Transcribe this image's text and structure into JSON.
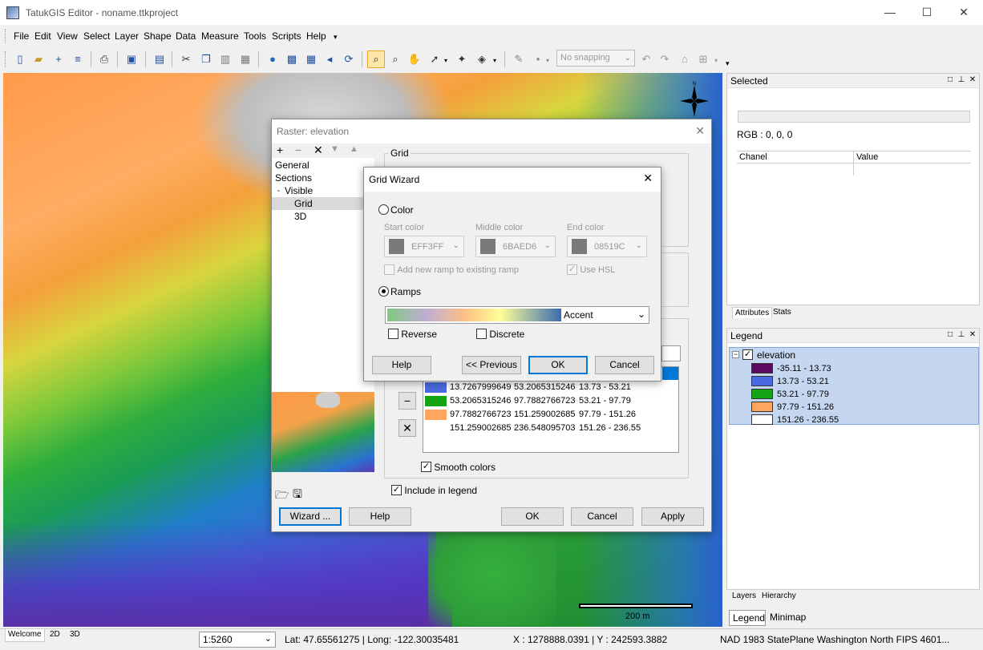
{
  "window": {
    "title": "TatukGIS Editor - noname.ttkproject",
    "minimize": "—",
    "maximize": "☐",
    "close": "✕"
  },
  "menu": [
    "File",
    "Edit",
    "View",
    "Select",
    "Layer",
    "Shape",
    "Data",
    "Measure",
    "Tools",
    "Scripts",
    "Help"
  ],
  "toolbar": {
    "snapping": "No snapping"
  },
  "map": {
    "scale_label": "200 m",
    "north_label": "N"
  },
  "selected_panel": {
    "title": "Selected",
    "rgb": "RGB : 0, 0, 0",
    "col_chanel": "Chanel",
    "col_value": "Value",
    "tab_attributes": "Attributes",
    "tab_stats": "Stats"
  },
  "legend_panel": {
    "title": "Legend",
    "layer_name": "elevation",
    "items": [
      {
        "label": "-35.11 - 13.73",
        "color": "#5b0a5f"
      },
      {
        "label": "13.73 - 53.21",
        "color": "#4a6ae0"
      },
      {
        "label": "53.21 - 97.79",
        "color": "#13a313"
      },
      {
        "label": "97.79 - 151.26",
        "color": "#ffa560"
      },
      {
        "label": "151.26 - 236.55",
        "color": "#ffffff"
      }
    ],
    "tab_layers": "Layers",
    "tab_hierarchy": "Hierarchy",
    "btab_legend": "Legend",
    "btab_minimap": "Minimap"
  },
  "raster_dialog": {
    "title": "Raster: elevation",
    "tree": [
      "General",
      "Sections",
      "Visible",
      "Grid",
      "3D"
    ],
    "group_title": "Grid",
    "rows": [
      {
        "c1": "13.7267999649",
        "c2": "53.2065315246",
        "c3": "13.73 - 53.21",
        "color": "#4a6ae0"
      },
      {
        "c1": "53.2065315246",
        "c2": "97.7882766723",
        "c3": "53.21 - 97.79",
        "color": "#13a313"
      },
      {
        "c1": "97.7882766723",
        "c2": "151.259002685",
        "c3": "97.79 - 151.26",
        "color": "#ffa560"
      },
      {
        "c1": "151.259002685",
        "c2": "236.548095703",
        "c3": "151.26 - 236.55",
        "color": "#ffffff"
      }
    ],
    "smooth_colors": "Smooth colors",
    "include_in_legend": "Include in legend",
    "btn_wizard": "Wizard ...",
    "btn_help": "Help",
    "btn_ok": "OK",
    "btn_cancel": "Cancel",
    "btn_apply": "Apply"
  },
  "grid_wizard": {
    "title": "Grid Wizard",
    "color_label": "Color",
    "start_color_label": "Start color",
    "middle_color_label": "Middle color",
    "end_color_label": "End color",
    "start_color": "EFF3FF",
    "middle_color": "6BAED6",
    "end_color": "08519C",
    "add_ramp": "Add new ramp to existing ramp",
    "use_hsl": "Use HSL",
    "ramps_label": "Ramps",
    "ramp_name": "Accent",
    "reverse": "Reverse",
    "discrete": "Discrete",
    "btn_help": "Help",
    "btn_previous": "<< Previous",
    "btn_ok": "OK",
    "btn_cancel": "Cancel"
  },
  "status": {
    "tab_welcome": "Welcome",
    "tab_2d": "2D",
    "tab_3d": "3D",
    "scale": "1:5260",
    "latlong": "Lat: 47.65561275 | Long: -122.30035481",
    "xy": "X : 1278888.0391 | Y : 242593.3882",
    "crs": "NAD 1983 StatePlane Washington North FIPS 4601..."
  }
}
